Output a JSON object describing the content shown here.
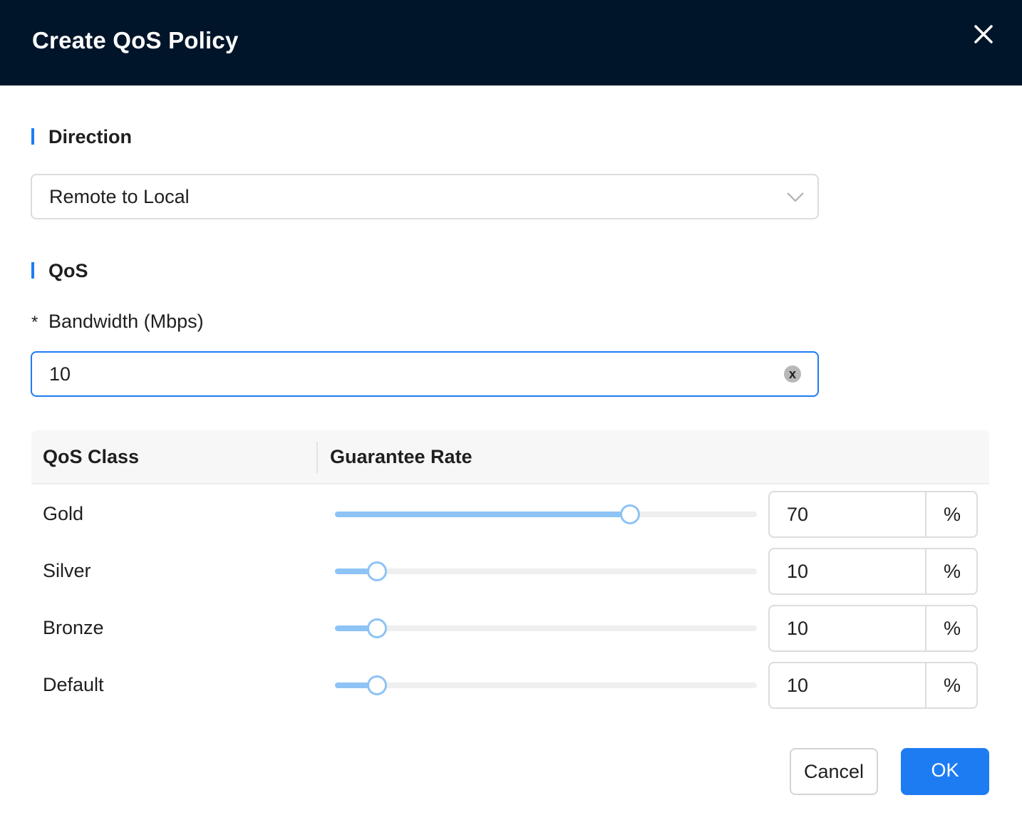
{
  "dialog": {
    "title": "Create QoS Policy"
  },
  "direction": {
    "section_title": "Direction",
    "selected": "Remote to Local"
  },
  "qos": {
    "section_title": "QoS",
    "bandwidth": {
      "required_marker": "*",
      "label": "Bandwidth (Mbps)",
      "value": "10",
      "clear_label": "x"
    },
    "table": {
      "headers": [
        "QoS Class",
        "Guarantee Rate"
      ],
      "rows": [
        {
          "class": "Gold",
          "rate": "70",
          "unit": "%",
          "percent": 70
        },
        {
          "class": "Silver",
          "rate": "10",
          "unit": "%",
          "percent": 10
        },
        {
          "class": "Bronze",
          "rate": "10",
          "unit": "%",
          "percent": 10
        },
        {
          "class": "Default",
          "rate": "10",
          "unit": "%",
          "percent": 10
        }
      ]
    }
  },
  "footer": {
    "cancel_label": "Cancel",
    "ok_label": "OK"
  },
  "colors": {
    "header_bg": "#00152a",
    "accent": "#1e7cf2",
    "slider": "#8ec3f5"
  }
}
